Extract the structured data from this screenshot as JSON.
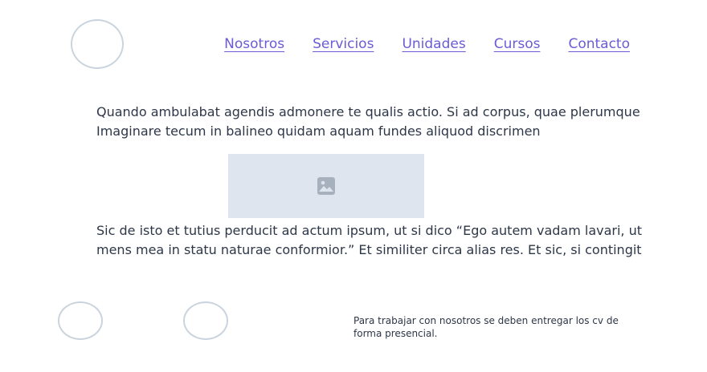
{
  "nav": {
    "items": [
      {
        "label": "Nosotros"
      },
      {
        "label": "Servicios"
      },
      {
        "label": "Unidades"
      },
      {
        "label": "Cursos"
      },
      {
        "label": "Contacto"
      }
    ]
  },
  "main": {
    "paragraph_1": "Quando ambulabat agendis admonere te qualis actio. Si ad corpus, quae plerumque Imaginare tecum in balineo quidam aquam fundes aliquod discrimen",
    "image_icon": "image-placeholder-icon",
    "paragraph_2": "Sic de isto et tutius perducit ad actum ipsum, ut si dico “Ego autem vadam lavari, ut mens mea in statu naturae conformior.” Et similiter circa alias res. Et sic, si contingit"
  },
  "footer": {
    "note": "Para trabajar con nosotros se deben entregar los cv de forma presencial."
  },
  "colors": {
    "link": "#6b5bd6",
    "text": "#2d3748",
    "placeholder_bg": "#dfe5ee",
    "circle_border": "#c9d4de"
  }
}
